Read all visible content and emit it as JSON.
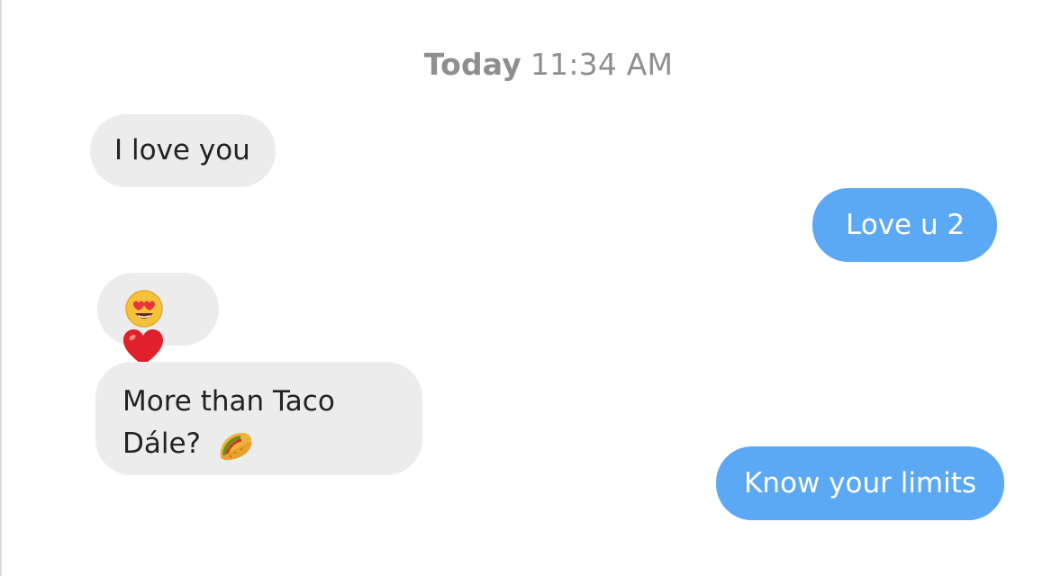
{
  "conversation": {
    "timestamp_day": "Today",
    "timestamp_time": "11:34 AM",
    "messages": [
      {
        "direction": "incoming",
        "text": "I love you"
      },
      {
        "direction": "outgoing",
        "text": "Love u 2"
      },
      {
        "direction": "incoming",
        "icon": "heart-eyes-emoji"
      },
      {
        "direction": "incoming",
        "text": "More than Taco Dále?",
        "icon": "taco-emoji"
      },
      {
        "direction": "outgoing",
        "text": "Know your limits"
      }
    ],
    "reaction_icon": "red-heart-emoji"
  },
  "colors": {
    "incoming_bubble": "#ececec",
    "outgoing_bubble": "#5ba9f4",
    "timestamp": "#8f8f8f"
  }
}
